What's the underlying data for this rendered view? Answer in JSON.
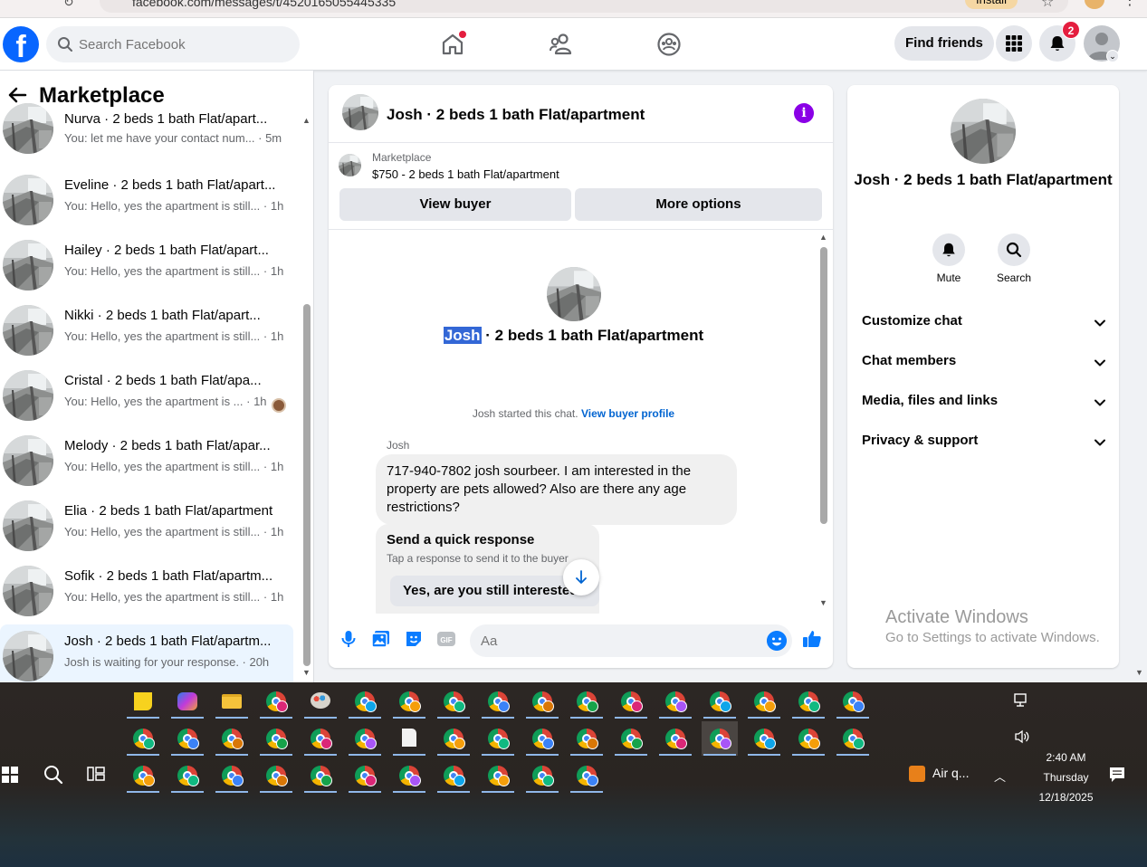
{
  "browser": {
    "url": "facebook.com/messages/t/4520165055445335",
    "install_label": "Install"
  },
  "header": {
    "logo": "f",
    "search_placeholder": "Search Facebook",
    "find_friends": "Find friends",
    "notification_count": "2"
  },
  "sidebar": {
    "title": "Marketplace",
    "conversations": [
      {
        "name": "Nurva · 2 beds 1 bath Flat/apart...",
        "preview": "You: let me have your contact num... · 5m"
      },
      {
        "name": "Eveline · 2 beds 1 bath Flat/apart...",
        "preview": "You: Hello, yes the apartment is still... · 1h"
      },
      {
        "name": "Hailey · 2 beds 1 bath Flat/apart...",
        "preview": "You: Hello, yes the apartment is still... · 1h"
      },
      {
        "name": "Nikki · 2 beds 1 bath Flat/apart...",
        "preview": "You: Hello, yes the apartment is still... · 1h"
      },
      {
        "name": "Cristal · 2 beds 1 bath Flat/apa...",
        "preview": "You: Hello, yes the apartment is ... · 1h"
      },
      {
        "name": "Melody · 2 beds 1 bath Flat/apar...",
        "preview": "You: Hello, yes the apartment is still... · 1h"
      },
      {
        "name": "Elia · 2 beds 1 bath Flat/apartment",
        "preview": "You: Hello, yes the apartment is still... · 1h"
      },
      {
        "name": "Sofik · 2 beds 1 bath Flat/apartm...",
        "preview": "You: Hello, yes the apartment is still... · 1h"
      },
      {
        "name": "Josh · 2 beds 1 bath Flat/apartm...",
        "preview": "Josh is waiting for your response. · 20h"
      }
    ]
  },
  "chat": {
    "title": "Josh · 2 beds 1 bath Flat/apartment",
    "listing_source": "Marketplace",
    "listing_price": "$750 - 2 beds 1 bath Flat/apartment",
    "view_buyer": "View buyer",
    "more_options": "More options",
    "intro_name_highlight": "Josh",
    "intro_name_rest": " · 2 beds 1 bath Flat/apartment",
    "started_text": "Josh started this chat.",
    "view_buyer_profile": "View buyer profile",
    "sender": "Josh",
    "message": "717-940-7802 josh sourbeer. I am interested in the property are pets allowed? Also are there any age restrictions?",
    "quick_title": "Send a quick response",
    "quick_subtitle": "Tap a response to send it to the buyer",
    "quick_reply": "Yes, are you still interested?",
    "composer_placeholder": "Aa"
  },
  "details": {
    "name": "Josh · 2 beds 1 bath Flat/apartment",
    "mute": "Mute",
    "search": "Search",
    "sections": [
      "Customize chat",
      "Chat members",
      "Media, files and links",
      "Privacy & support"
    ]
  },
  "watermark": {
    "line1": "Activate Windows",
    "line2": "Go to Settings to activate Windows."
  },
  "taskbar": {
    "air_quality": "Air q...",
    "time": "2:40 AM",
    "day": "Thursday",
    "date": "12/18/2025"
  }
}
